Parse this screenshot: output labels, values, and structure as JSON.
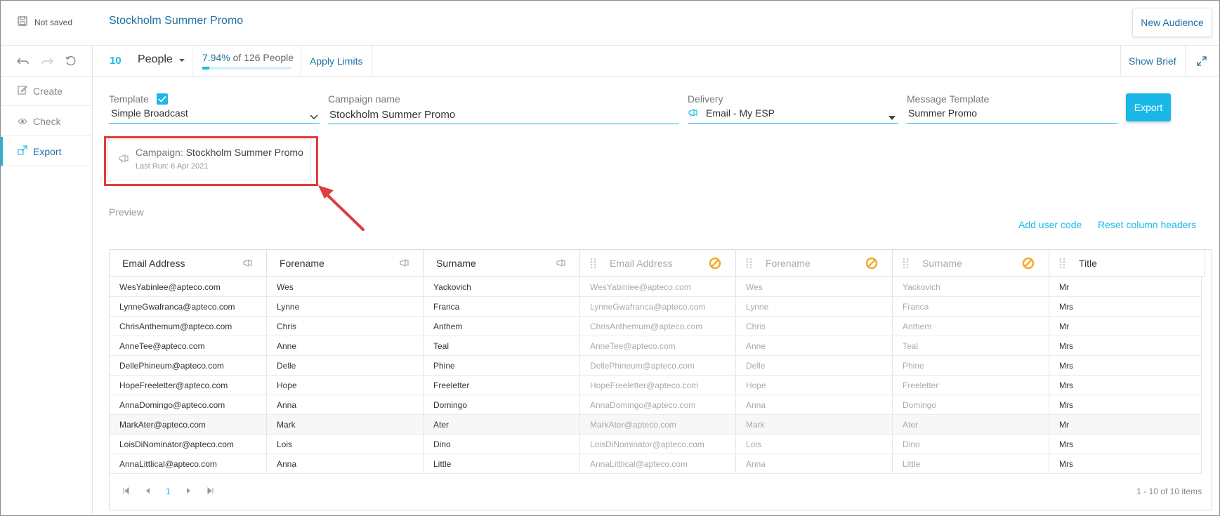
{
  "header": {
    "save_status": "Not saved",
    "title": "Stockholm Summer Promo",
    "new_audience": "New Audience"
  },
  "toolbar": {
    "count": "10",
    "people_selector": "People",
    "percent": "7.94%",
    "of_people": "of 126 People",
    "progress_percent": 7.94,
    "apply_limits": "Apply Limits",
    "show_brief": "Show Brief"
  },
  "nav": {
    "create": "Create",
    "check": "Check",
    "export": "Export"
  },
  "form": {
    "template_label": "Template",
    "template_value": "Simple Broadcast",
    "campaign_label": "Campaign name",
    "campaign_value": "Stockholm Summer Promo",
    "delivery_label": "Delivery",
    "delivery_value": "Email - My ESP",
    "message_label": "Message Template",
    "message_value": "Summer Promo",
    "export_button": "Export"
  },
  "campaign_box": {
    "prefix": "Campaign:",
    "name": "Stockholm Summer Promo",
    "last_run": "Last Run: 6 Apr 2021"
  },
  "preview": {
    "label": "Preview",
    "add_user_code": "Add user code",
    "reset_headers": "Reset column headers"
  },
  "grid": {
    "columns": [
      "Email Address",
      "Forename",
      "Surname",
      "Email Address",
      "Forename",
      "Surname",
      "Title"
    ],
    "rows": [
      [
        "WesYabinlee@apteco.com",
        "Wes",
        "Yackovich",
        "Mr"
      ],
      [
        "LynneGwafranca@apteco.com",
        "Lynne",
        "Franca",
        "Mrs"
      ],
      [
        "ChrisAnthemum@apteco.com",
        "Chris",
        "Anthem",
        "Mr"
      ],
      [
        "AnneTee@apteco.com",
        "Anne",
        "Teal",
        "Mrs"
      ],
      [
        "DellePhineum@apteco.com",
        "Delle",
        "Phine",
        "Mrs"
      ],
      [
        "HopeFreeletter@apteco.com",
        "Hope",
        "Freeletter",
        "Mrs"
      ],
      [
        "AnnaDomingo@apteco.com",
        "Anna",
        "Domingo",
        "Mrs"
      ],
      [
        "MarkAter@apteco.com",
        "Mark",
        "Ater",
        "Mr"
      ],
      [
        "LoisDiNominator@apteco.com",
        "Lois",
        "Dino",
        "Mrs"
      ],
      [
        "AnnaLittlical@apteco.com",
        "Anna",
        "Little",
        "Mrs"
      ]
    ],
    "page": "1",
    "items_info": "1 - 10 of 10 items"
  },
  "colors": {
    "accent": "#1ab8e6",
    "link": "#1f6fa3",
    "exclude": "#f5a623",
    "highlight": "#e03c3c"
  }
}
